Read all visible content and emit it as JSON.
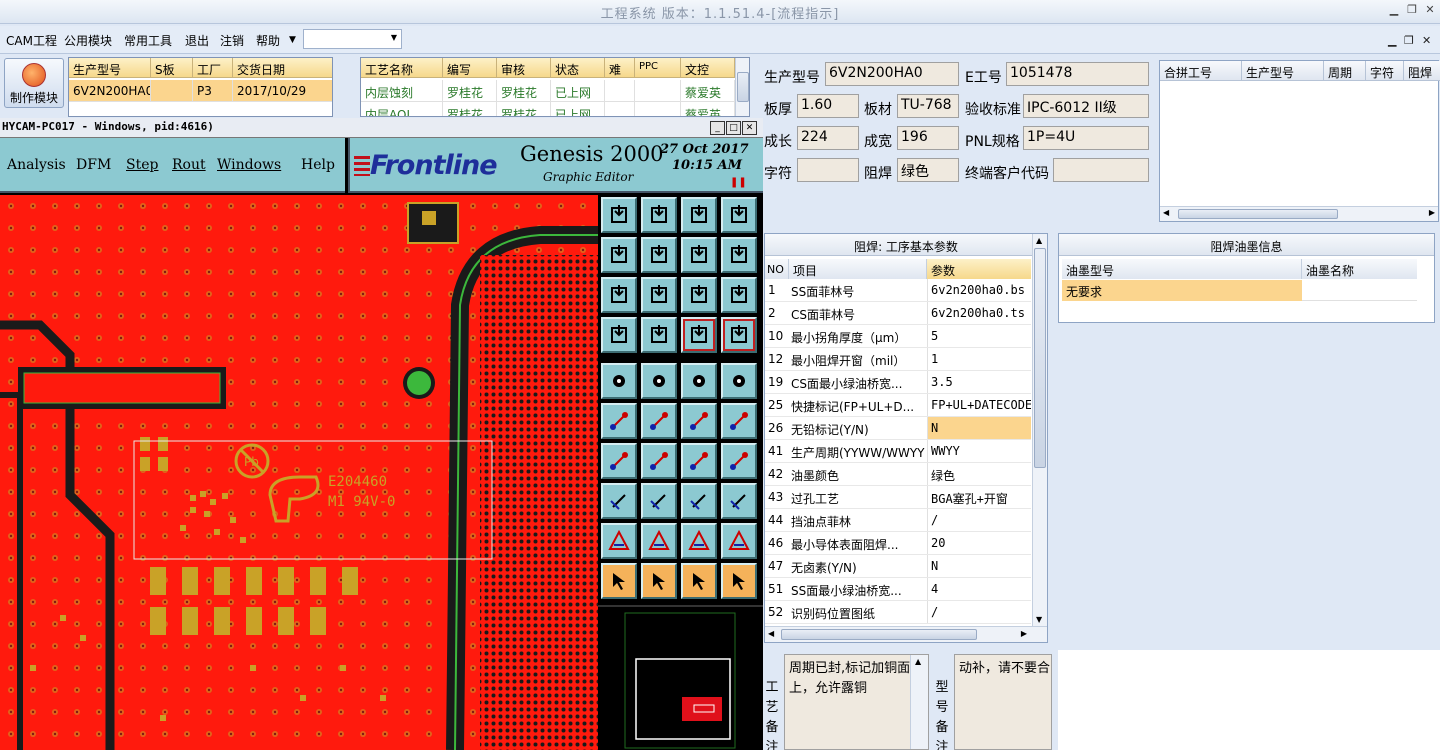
{
  "window": {
    "title": "工程系统 版本：1.1.51.4-[流程指示]"
  },
  "menu": {
    "items": [
      "CAM工程",
      "公用模块",
      "常用工具",
      "退出",
      "注销",
      "帮助"
    ],
    "combo_value": ""
  },
  "module_button": {
    "label": "制作模块"
  },
  "job_grid": {
    "headers": [
      "生产型号",
      "S板",
      "工厂",
      "交货日期"
    ],
    "rows": [
      [
        "6V2N200HA0",
        "",
        "P3",
        "2017/10/29"
      ]
    ]
  },
  "process_grid": {
    "headers": [
      "工艺名称",
      "编写",
      "审核",
      "状态",
      "难",
      "PPC",
      "文控"
    ],
    "rows": [
      [
        "内层蚀刻",
        "罗桂花",
        "罗桂花",
        "已上网",
        "",
        "",
        "蔡爱英"
      ],
      [
        "内层AOI",
        "罗桂花",
        "罗桂花",
        "已上网",
        "",
        "",
        "蔡爱英"
      ]
    ]
  },
  "genesis": {
    "title": "HYCAM-PC017 - Windows, pid:4616)",
    "menu": [
      "Analysis",
      "DFM",
      "Step",
      "Rout",
      "Windows",
      "Help"
    ],
    "brand": "Frontline",
    "product": "Genesis 2000",
    "subtitle": "Graphic Editor",
    "date": "27 Oct 2017",
    "time": "10:15 AM",
    "canvas": {
      "ul_mark": "Pb",
      "text1": "E204460",
      "text2": "M1 94V-0"
    }
  },
  "info": {
    "labels": {
      "model": "生产型号",
      "eno": "E工号",
      "thick": "板厚",
      "material": "板材",
      "std": "验收标准",
      "clen": "成长",
      "cwid": "成宽",
      "pnl": "PNL规格",
      "char": "字符",
      "mask": "阻焊",
      "customer": "终端客户代码"
    },
    "values": {
      "model": "6V2N200HA0",
      "eno": "1051478",
      "thick": "1.60",
      "material": "TU-768",
      "std": "IPC-6012 II级",
      "clen": "224",
      "cwid": "196",
      "pnl": "1P=4U",
      "char": "",
      "mask": "绿色",
      "customer": ""
    }
  },
  "merge_grid": {
    "headers": [
      "合拼工号",
      "生产型号",
      "周期",
      "字符",
      "阻焊"
    ]
  },
  "params": {
    "title": "阻焊: 工序基本参数",
    "headers": [
      "NO",
      "项目",
      "参数"
    ],
    "rows": [
      {
        "no": "1",
        "item": "SS面菲林号",
        "val": "6v2n200ha0.bs"
      },
      {
        "no": "2",
        "item": "CS面菲林号",
        "val": "6v2n200ha0.ts"
      },
      {
        "no": "10",
        "item": "最小拐角厚度（μm）",
        "val": "5"
      },
      {
        "no": "12",
        "item": "最小阻焊开窗（mil）",
        "val": "1"
      },
      {
        "no": "19",
        "item": "CS面最小绿油桥宽...",
        "val": "3.5"
      },
      {
        "no": "25",
        "item": "快捷标记(FP+UL+D...",
        "val": "FP+UL+DATECODE"
      },
      {
        "no": "26",
        "item": "无铅标记(Y/N)",
        "val": "N"
      },
      {
        "no": "41",
        "item": "生产周期(YYWW/WWYY)",
        "val": "WWYY"
      },
      {
        "no": "42",
        "item": "油墨颜色",
        "val": "绿色"
      },
      {
        "no": "43",
        "item": "过孔工艺",
        "val": "BGA塞孔+开窗"
      },
      {
        "no": "44",
        "item": "挡油点菲林",
        "val": "/"
      },
      {
        "no": "46",
        "item": "最小导体表面阻焊...",
        "val": "20"
      },
      {
        "no": "47",
        "item": "无卤素(Y/N)",
        "val": "N"
      },
      {
        "no": "51",
        "item": "SS面最小绿油桥宽...",
        "val": "4"
      },
      {
        "no": "52",
        "item": "识别码位置图纸",
        "val": "/"
      }
    ]
  },
  "ink": {
    "title": "阻焊油墨信息",
    "headers": [
      "油墨型号",
      "油墨名称"
    ],
    "rows": [
      [
        "无要求",
        ""
      ]
    ]
  },
  "notes": {
    "process_label": "工艺备注",
    "process_text": "周期已封,标记加铜面上，允许露铜",
    "model_label": "型号备注",
    "model_text": "动补，请不要合"
  },
  "colors": {
    "pcb_red": "#ff1a0d",
    "pcb_pad": "#c9a227",
    "pcb_dark": "#1a1a1a",
    "pcb_via": "#3cb83c",
    "accent_orange": "#f6b04a",
    "tool_cyan": "#8cc9d1"
  }
}
